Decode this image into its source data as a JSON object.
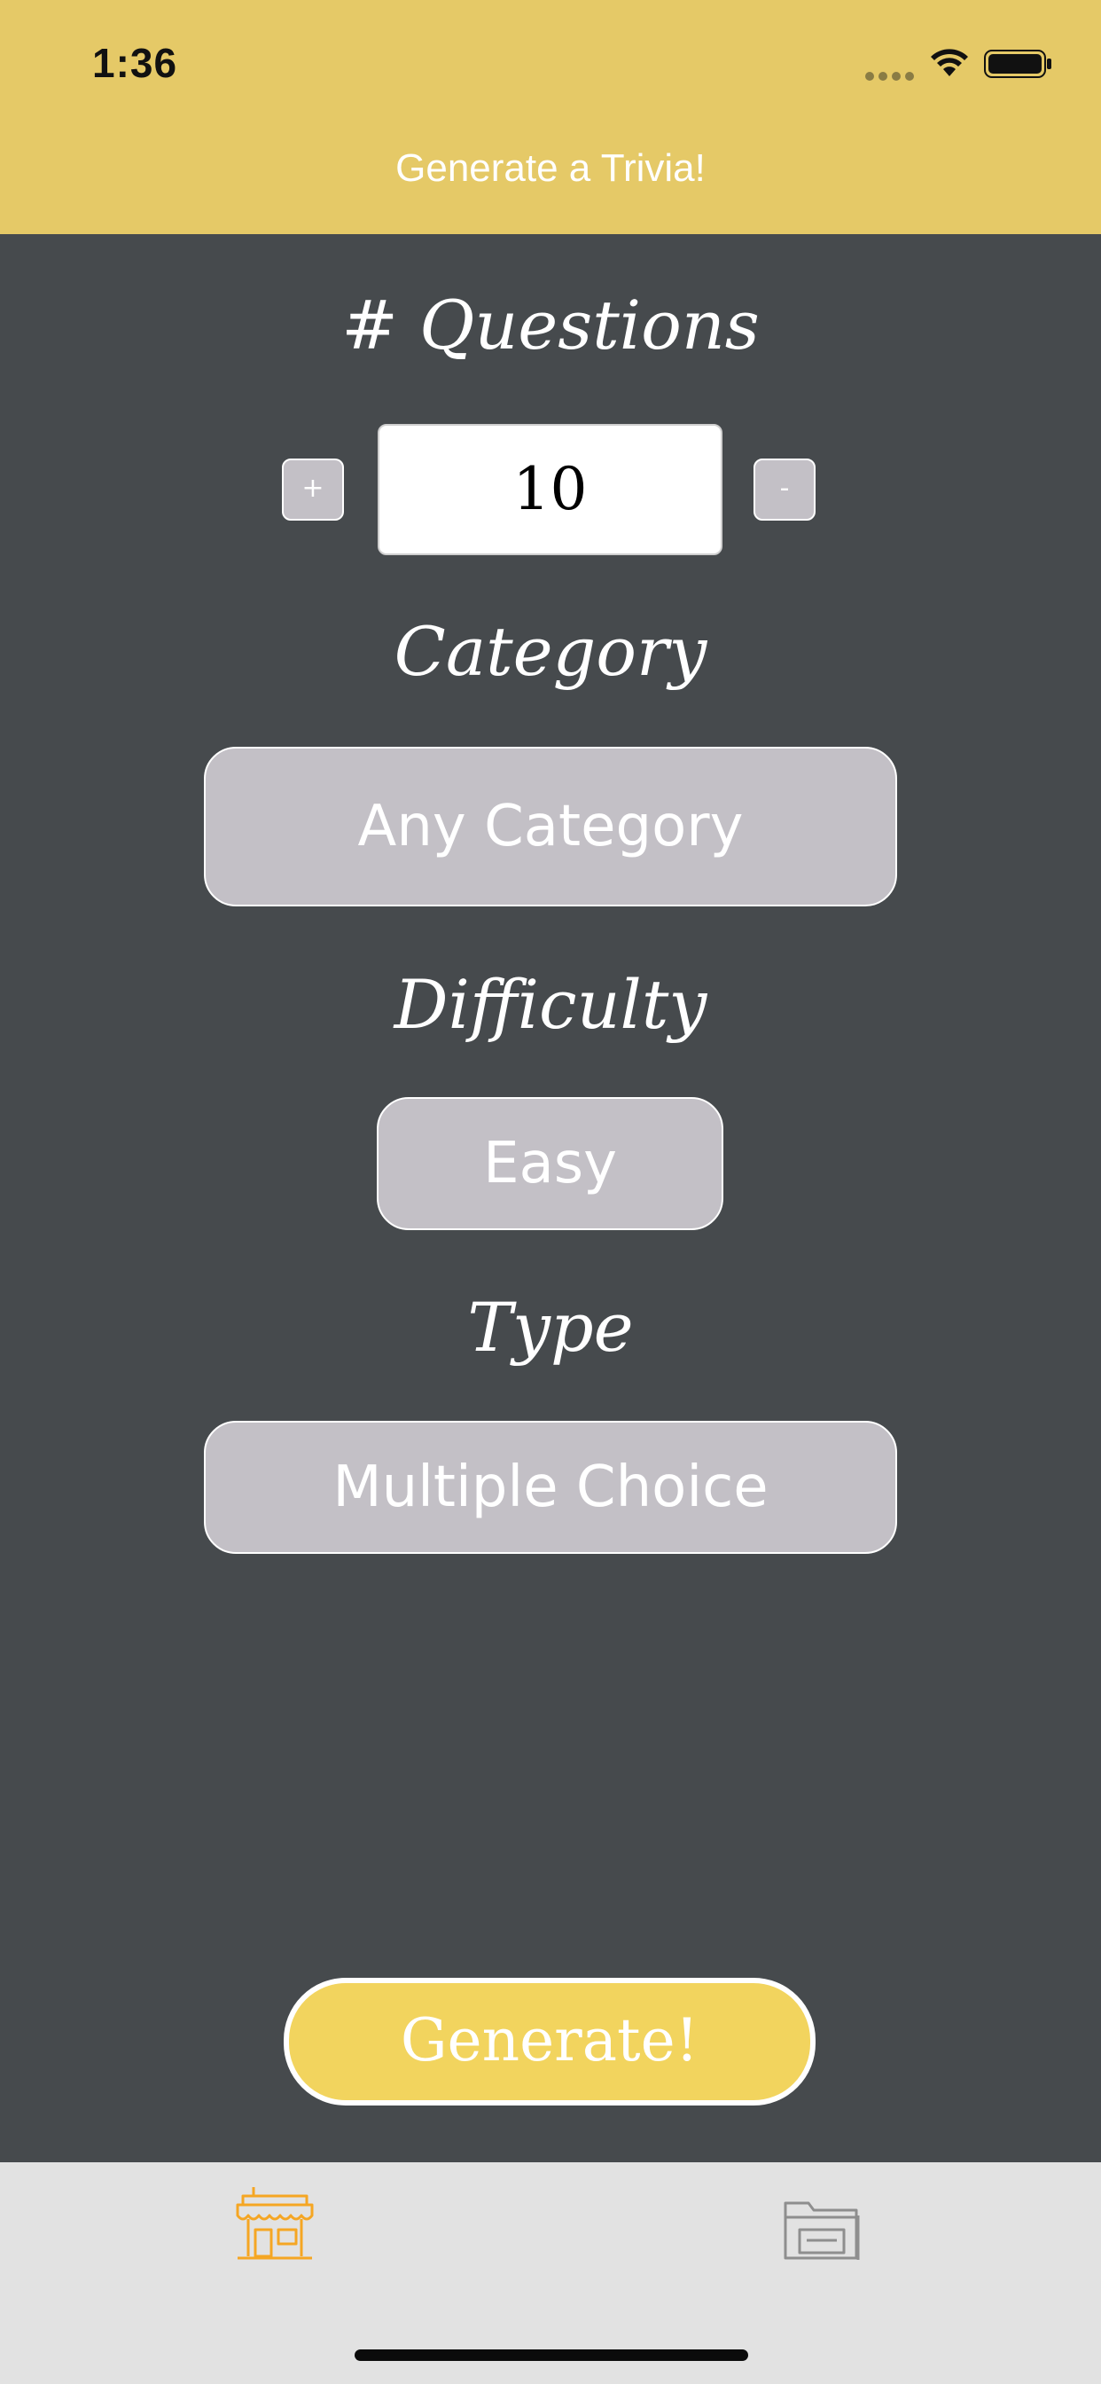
{
  "status_bar": {
    "time": "1:36"
  },
  "nav": {
    "title": "Generate a Trivia!"
  },
  "questions": {
    "label": "# Questions",
    "value": "10",
    "increment_label": "+",
    "decrement_label": "-"
  },
  "category": {
    "label": "Category",
    "selected": "Any Category"
  },
  "difficulty": {
    "label": "Difficulty",
    "selected": "Easy"
  },
  "type": {
    "label": "Type",
    "selected": "Multiple Choice"
  },
  "generate_label": "Generate!",
  "tabs": [
    {
      "icon": "store-icon",
      "active": true
    },
    {
      "icon": "folder-icon",
      "active": false
    }
  ],
  "colors": {
    "header": "#e5c967",
    "background": "#464a4d",
    "pill": "#c3c0c6",
    "generate": "#f2d45e",
    "active_tab": "#f5a623",
    "inactive_tab": "#8e8e8e"
  }
}
